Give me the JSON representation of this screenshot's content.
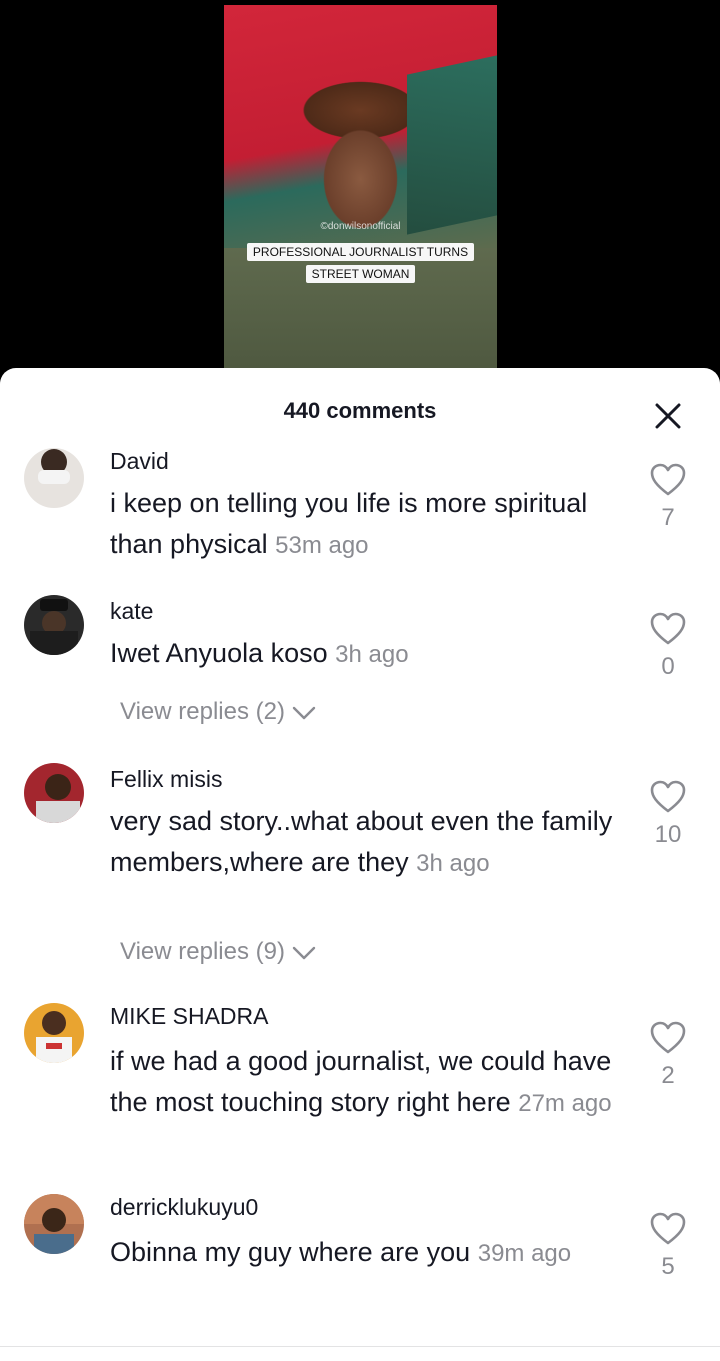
{
  "video": {
    "watermark": "©donwilsonofficial",
    "caption_line1": "PROFESSIONAL JOURNALIST TURNS",
    "caption_line2": "STREET WOMAN"
  },
  "sheet": {
    "title": "440 comments"
  },
  "comments": [
    {
      "username": "David",
      "text": "i keep on telling you life is more spiritual than physical",
      "time": "53m ago",
      "likes": "7",
      "avatar_color": "#d9d2cc"
    },
    {
      "username": "kate",
      "text": "Iwet Anyuola koso",
      "time": "3h ago",
      "likes": "0",
      "replies": "View replies (2)",
      "avatar_color": "#2a2a2a"
    },
    {
      "username": "Fellix misis",
      "text": "very sad story..what about even the family members,where are they",
      "time": "3h ago",
      "likes": "10",
      "replies": "View replies (9)",
      "avatar_color": "#a3262e"
    },
    {
      "username": "MIKE SHADRA",
      "text": "if we had a good journalist, we could have the most touching story right here",
      "time": "27m ago",
      "likes": "2",
      "avatar_color": "#e9a430"
    },
    {
      "username": "derricklukuyu0",
      "text": "Obinna my guy where are you",
      "time": "39m ago",
      "likes": "5",
      "avatar_color": "#4a6d8c"
    }
  ],
  "icons": {
    "close": "close-icon",
    "like": "heart-outline-icon",
    "chevron": "chevron-down-icon"
  }
}
